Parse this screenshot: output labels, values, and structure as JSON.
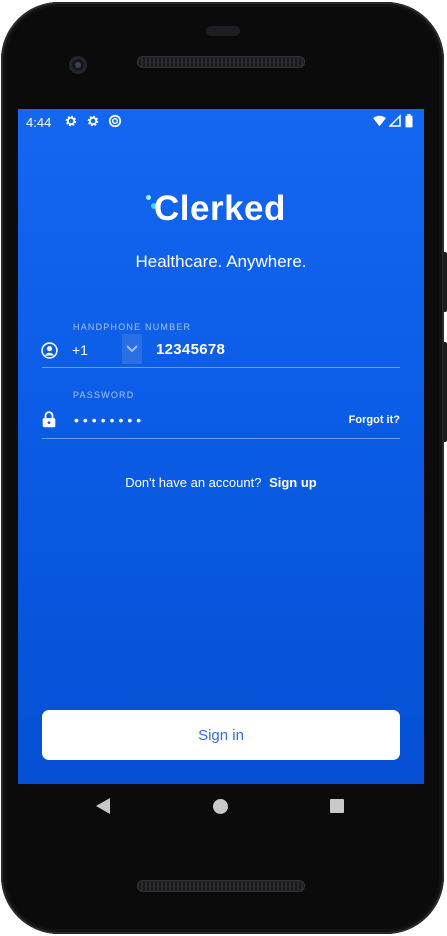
{
  "status_bar": {
    "time": "4:44"
  },
  "app": {
    "logo_text": "Clerked",
    "tagline": "Healthcare. Anywhere.",
    "brand_color": "#0b5ce6"
  },
  "phone_field": {
    "label": "HANDPHONE NUMBER",
    "country_code": "+1",
    "value": "12345678"
  },
  "password_field": {
    "label": "PASSWORD",
    "value_masked": "••••••••",
    "forgot_label": "Forgot it?"
  },
  "signup": {
    "prompt": "Don't have an account?",
    "link_label": "Sign up"
  },
  "signin_button": {
    "label": "Sign in"
  },
  "icons": {
    "status": [
      "settings-icon",
      "settings-icon",
      "sync-icon",
      "wifi-icon",
      "cellular-icon",
      "battery-icon"
    ],
    "phone_field": "user-circle-icon",
    "password_field": "lock-icon",
    "navigation": [
      "back-icon",
      "home-icon",
      "recents-icon"
    ]
  }
}
